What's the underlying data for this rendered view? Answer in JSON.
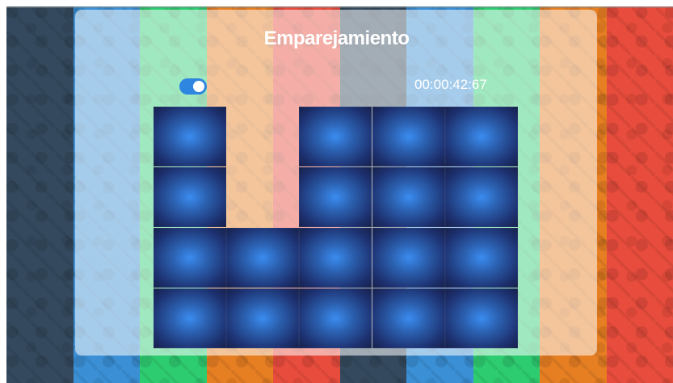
{
  "game": {
    "title": "Emparejamiento",
    "timer": "00:00:42:67",
    "toggle_on": true
  },
  "theme": {
    "stripe_colors": [
      "#34495e",
      "#3a8fd5",
      "#2ecc71",
      "#e67e22",
      "#e74c3c",
      "#34495e",
      "#3a8fd5",
      "#2ecc71",
      "#e67e22",
      "#e74c3c"
    ]
  },
  "board": {
    "columns": 5,
    "rows": 4,
    "cells": [
      [
        1,
        0,
        1,
        1,
        1
      ],
      [
        1,
        0,
        1,
        1,
        1
      ],
      [
        1,
        1,
        1,
        1,
        1
      ],
      [
        1,
        1,
        1,
        1,
        1
      ]
    ]
  }
}
